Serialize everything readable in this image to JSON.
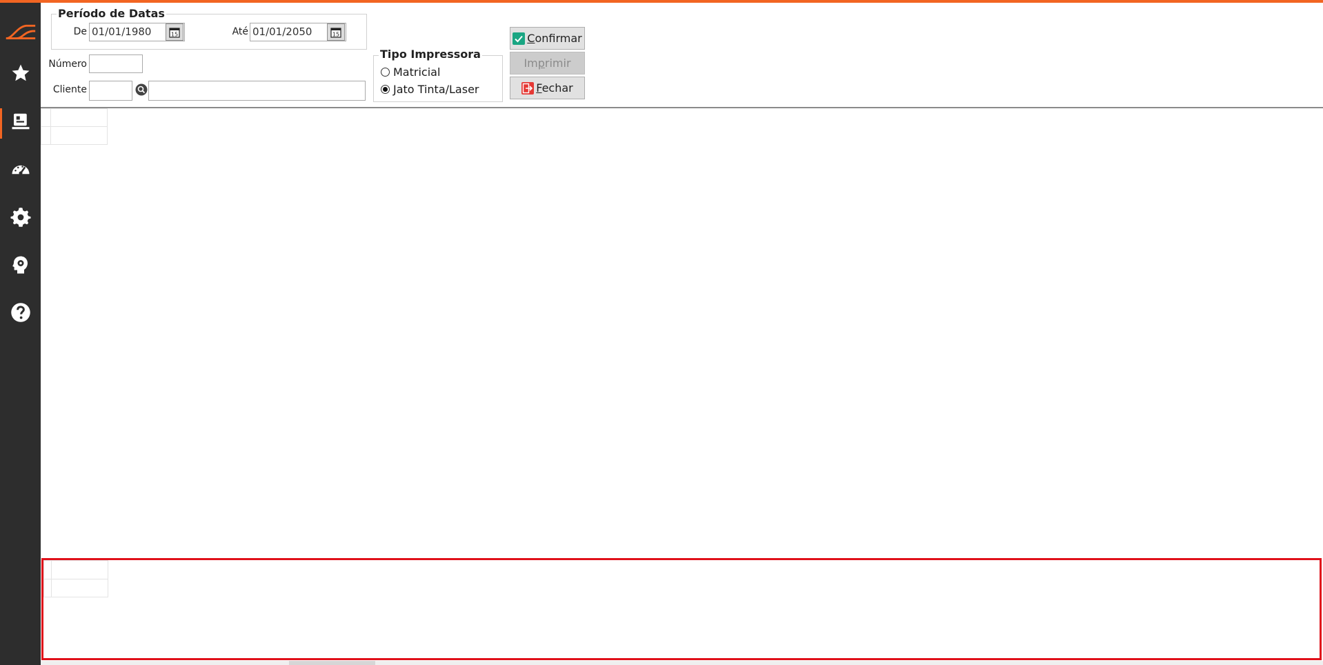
{
  "periodo": {
    "legend": "Período de Datas",
    "de_label": "De",
    "de_value": "01/01/1980",
    "ate_label": "Até",
    "ate_value": "01/01/2050",
    "calendar_icon_text": "15"
  },
  "numero": {
    "label": "Número",
    "value": ""
  },
  "cliente": {
    "label": "Cliente",
    "code": "",
    "name": ""
  },
  "tipo_impressora": {
    "legend": "Tipo Impressora",
    "options": [
      {
        "label": "Matricial",
        "selected": false
      },
      {
        "label": "Jato Tinta/Laser",
        "selected": true
      }
    ]
  },
  "buttons": {
    "confirmar": "Confirmar",
    "imprimir": "Imprimir",
    "fechar": "Fechar"
  },
  "colors": {
    "accent": "#f26522",
    "sidebar_bg": "#2d2d2d",
    "highlight_border": "#e0101a",
    "confirm_icon": "#1aa683",
    "close_icon": "#e53935"
  },
  "sidebar": {
    "icons": [
      "logo-icon",
      "star-icon",
      "reports-icon",
      "dashboard-icon",
      "gear-icon",
      "brain-gear-icon",
      "help-icon"
    ]
  }
}
